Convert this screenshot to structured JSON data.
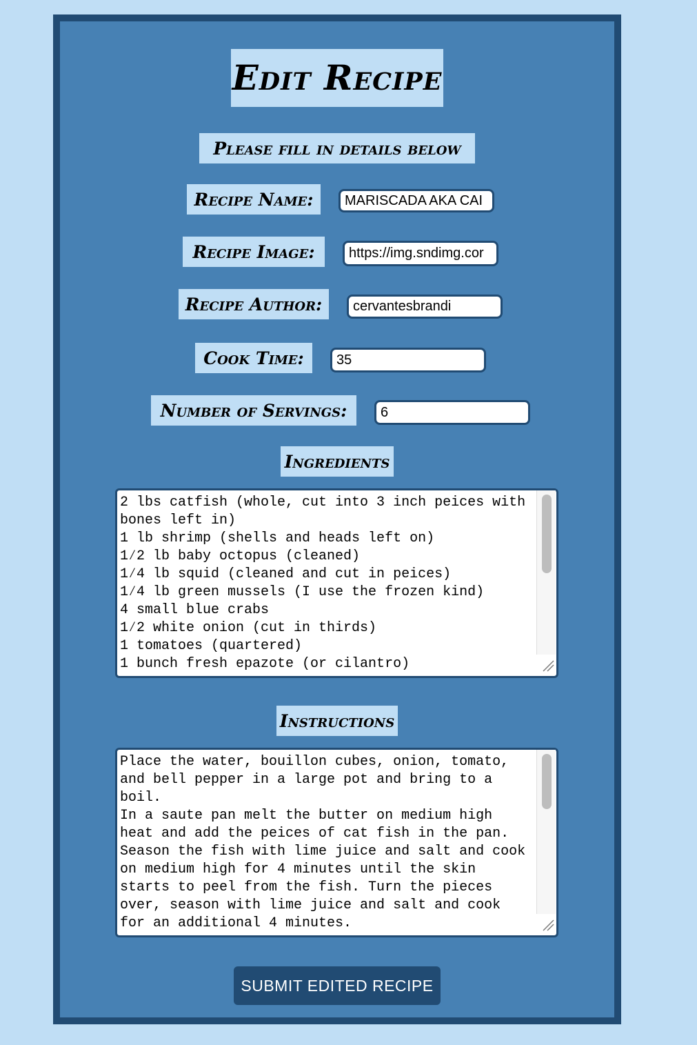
{
  "form": {
    "title": "Edit Recipe",
    "subtitle": "Please fill in details below",
    "fields": {
      "recipe_name": {
        "label": "Recipe Name:",
        "value": "MARISCADA AKA CAI"
      },
      "recipe_image": {
        "label": "Recipe Image:",
        "value": "https://img.sndimg.cor"
      },
      "recipe_author": {
        "label": "Recipe Author:",
        "value": "cervantesbrandi"
      },
      "cook_time": {
        "label": "Cook Time:",
        "value": "35"
      },
      "servings": {
        "label": "Number of Servings:",
        "value": "6"
      }
    },
    "ingredients": {
      "label": "Ingredients",
      "value": "2 lbs catfish (whole, cut into 3 inch peices with bones left in)\n1 lb shrimp (shells and heads left on)\n1⁄2 lb baby octopus (cleaned)\n1⁄4 lb squid (cleaned and cut in peices)\n1⁄4 lb green mussels (I use the frozen kind)\n4 small blue crabs\n1⁄2 white onion (cut in thirds)\n1 tomatoes (quartered)\n1 bunch fresh epazote (or cilantro)"
    },
    "instructions": {
      "label": "Instructions",
      "value": "Place the water, bouillon cubes, onion, tomato, and bell pepper in a large pot and bring to a boil.\nIn a saute pan melt the butter on medium high heat and add the peices of cat fish in the pan. Season the fish with lime juice and salt and cook on medium high for 4 minutes until the skin starts to peel from the fish. Turn the pieces over, season with lime juice and salt and cook for an additional 4 minutes."
    },
    "submit_label": "SUBMIT EDITED RECIPE"
  },
  "colors": {
    "page_background": "#c0def5",
    "card_background": "#4781b4",
    "card_border": "#214b73",
    "label_highlight": "#c0def5",
    "button_background": "#214b73",
    "button_text": "#ffffff"
  },
  "icons": {
    "textarea_resize": "resize-grip-icon"
  }
}
